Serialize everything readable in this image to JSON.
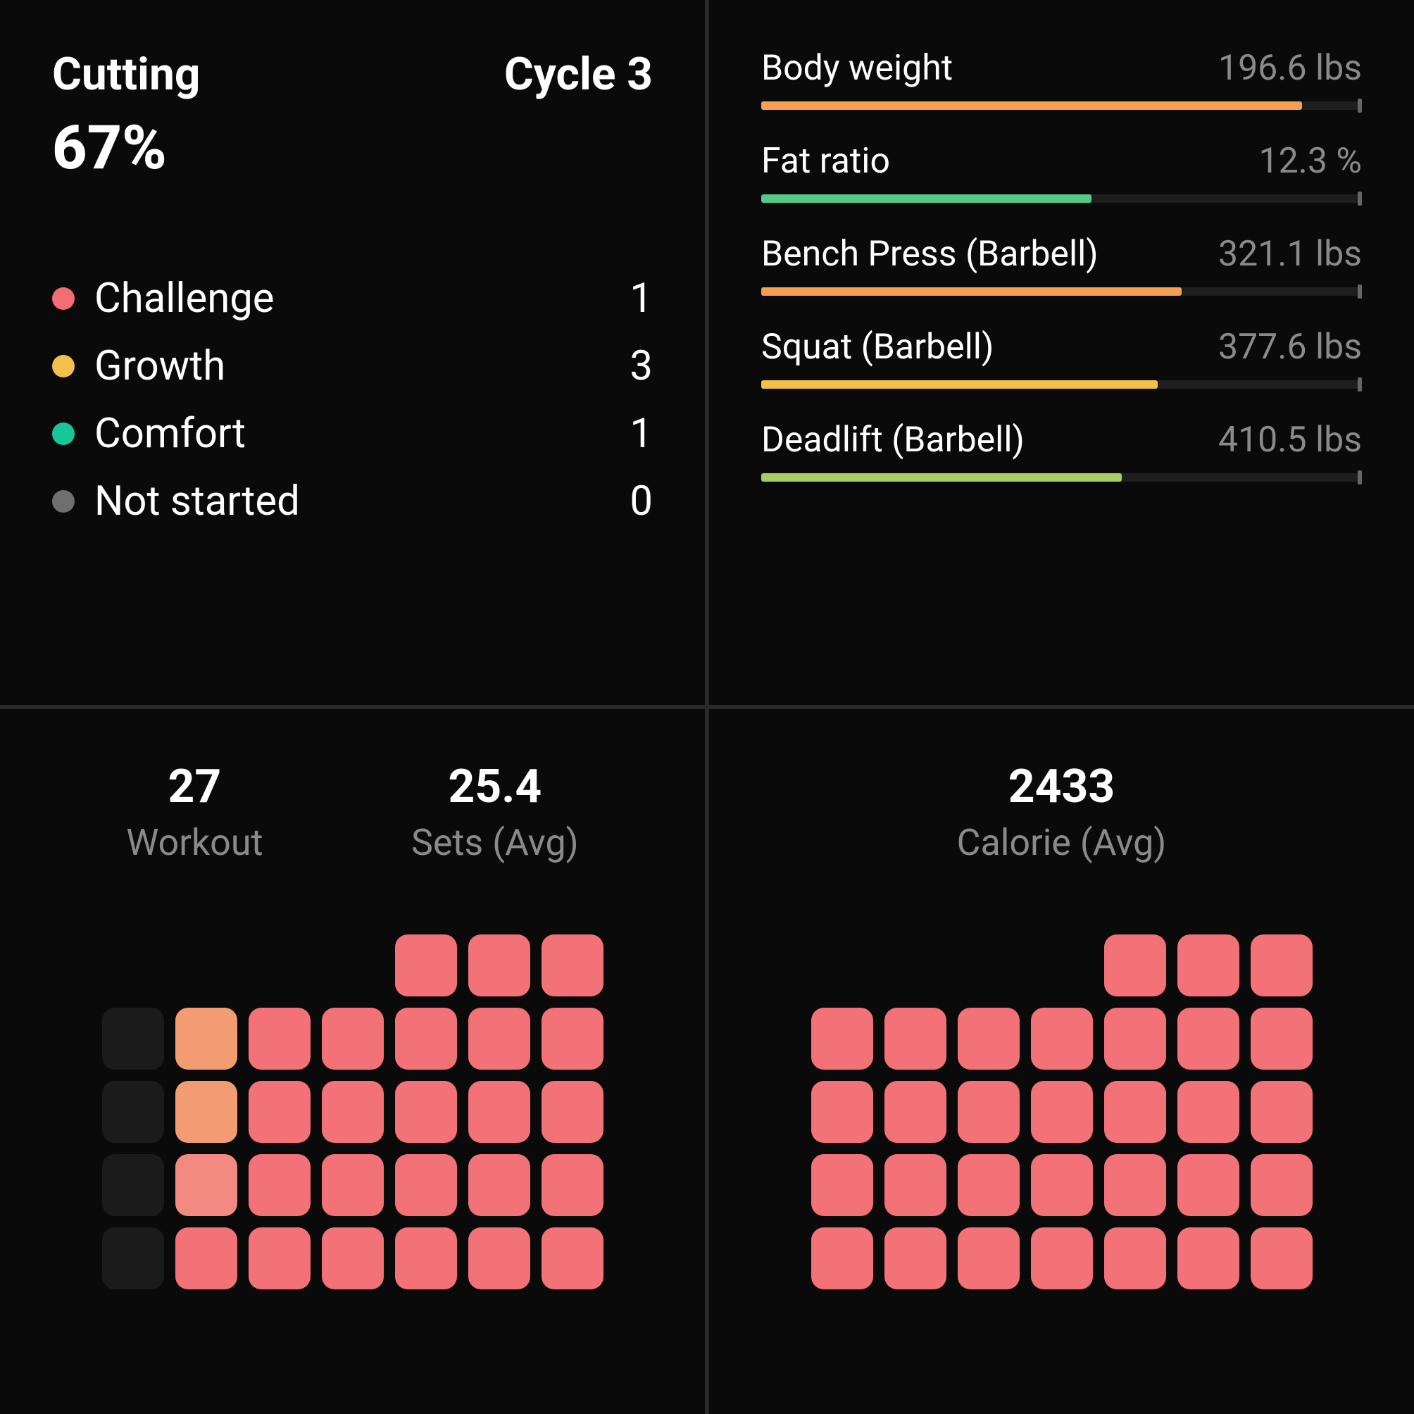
{
  "top_left": {
    "title": "Cutting",
    "cycle": "Cycle 3",
    "percent": "67%",
    "items": [
      {
        "label": "Challenge",
        "count": "1",
        "color": "#f26d74"
      },
      {
        "label": "Growth",
        "count": "3",
        "color": "#f3c14b"
      },
      {
        "label": "Comfort",
        "count": "1",
        "color": "#17c79a"
      },
      {
        "label": "Not started",
        "count": "0",
        "color": "#6f6f6f"
      }
    ]
  },
  "top_right": {
    "metrics": [
      {
        "name": "Body weight",
        "value": "196.6 lbs",
        "pct": 90,
        "color": "#f59f53"
      },
      {
        "name": "Fat ratio",
        "value": "12.3 %",
        "pct": 55,
        "color": "#54c987"
      },
      {
        "name": "Bench Press (Barbell)",
        "value": "321.1 lbs",
        "pct": 70,
        "color": "#f59f53"
      },
      {
        "name": "Squat (Barbell)",
        "value": "377.6 lbs",
        "pct": 66,
        "color": "#f3c14b"
      },
      {
        "name": "Deadlift (Barbell)",
        "value": "410.5 lbs",
        "pct": 60,
        "color": "#a5cd61"
      }
    ]
  },
  "bottom_left": {
    "stats": [
      {
        "value": "27",
        "label": "Workout"
      },
      {
        "value": "25.4",
        "label": "Sets (Avg)"
      }
    ],
    "heatmap": [
      [
        "empty",
        "empty",
        "empty",
        "empty",
        "red",
        "red",
        "red"
      ],
      [
        "dark",
        "orange",
        "red",
        "red",
        "red",
        "red",
        "red"
      ],
      [
        "dark",
        "orange",
        "red",
        "red",
        "red",
        "red",
        "red"
      ],
      [
        "dark",
        "red-light",
        "red",
        "red",
        "red",
        "red",
        "red"
      ],
      [
        "dark",
        "red",
        "red",
        "red",
        "red",
        "red",
        "red"
      ]
    ]
  },
  "bottom_right": {
    "stats": [
      {
        "value": "2433",
        "label": "Calorie (Avg)"
      }
    ],
    "heatmap": [
      [
        "empty",
        "empty",
        "empty",
        "empty",
        "red",
        "red",
        "red"
      ],
      [
        "red",
        "red",
        "red",
        "red",
        "red",
        "red",
        "red"
      ],
      [
        "red",
        "red",
        "red",
        "red",
        "red",
        "red",
        "red"
      ],
      [
        "red",
        "red",
        "red",
        "red",
        "red",
        "red",
        "red"
      ],
      [
        "red",
        "red",
        "red",
        "red",
        "red",
        "red",
        "red"
      ]
    ]
  }
}
